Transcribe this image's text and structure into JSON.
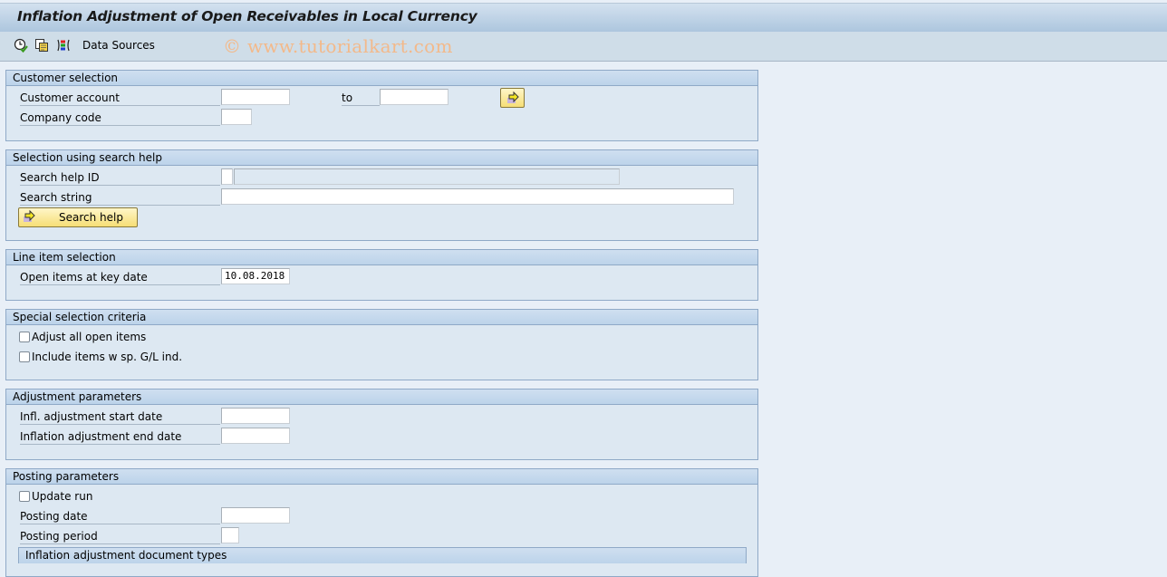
{
  "window": {
    "title": "Inflation Adjustment of Open Receivables in Local Currency"
  },
  "toolbar": {
    "execute_icon": "clock-check-icon",
    "variants_icon": "copy-variant-icon",
    "selection_options_icon": "multicolor-bracket-icon",
    "data_sources_label": "Data Sources",
    "watermark": "© www.tutorialkart.com"
  },
  "groups": {
    "customer_selection": {
      "title": "Customer selection",
      "customer_account_label": "Customer account",
      "customer_account_from": "",
      "to_label": "to",
      "customer_account_to": "",
      "multiple_selection_icon": "arrow-right-icon",
      "company_code_label": "Company code",
      "company_code_value": ""
    },
    "search_help": {
      "title": "Selection using search help",
      "search_help_id_label": "Search help ID",
      "search_help_id_value": "",
      "search_help_desc_value": "",
      "search_string_label": "Search string",
      "search_string_value": "",
      "search_help_button": "Search help"
    },
    "line_item": {
      "title": "Line item selection",
      "key_date_label": "Open items at key date",
      "key_date_value": "10.08.2018"
    },
    "special": {
      "title": "Special selection criteria",
      "adjust_all_label": "Adjust all open items",
      "adjust_all_checked": false,
      "include_items_label": "Include items w sp. G/L ind.",
      "include_items_checked": false
    },
    "adjustment": {
      "title": "Adjustment parameters",
      "start_date_label": "Infl. adjustment start date",
      "start_date_value": "",
      "end_date_label": "Inflation adjustment end date",
      "end_date_value": ""
    },
    "posting": {
      "title": "Posting parameters",
      "update_run_label": "Update run",
      "update_run_checked": false,
      "posting_date_label": "Posting date",
      "posting_date_value": "",
      "posting_period_label": "Posting period",
      "posting_period_value": "",
      "doc_types_title": "Inflation adjustment document types"
    }
  }
}
